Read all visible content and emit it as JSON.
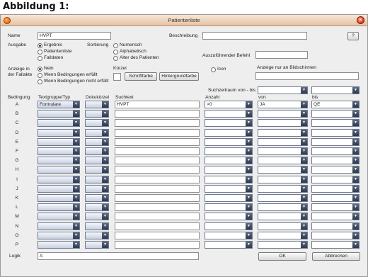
{
  "heading": "Abbildung 1:",
  "window": {
    "title": "Patientenliste",
    "help": "?"
  },
  "top": {
    "name_label": "Name",
    "name_value": "HVPT",
    "beschreibung_label": "Beschreibung",
    "beschreibung_value": "",
    "ausgabe_label": "Ausgabe",
    "ausgabe_options": [
      "Ergebnis",
      "Patientenliste",
      "Falldaten"
    ],
    "sortierung_label": "Sortierung",
    "sortierung_options": [
      "Numerisch",
      "Alphabetisch",
      "Alter des Patienten"
    ],
    "befehl_label": "Auszuführender Befehl",
    "befehl_value": "",
    "anzeige_label_1": "Anzeige in",
    "anzeige_label_2": "der Fallakte",
    "anzeige_options": [
      "Nein",
      "Wenn Bedingungen erfüllt",
      "Wenn Bedingungen nicht erfüllt"
    ],
    "kuerzel_label": "Kürzel",
    "kuerzel_value": "",
    "schriftfarbe": "Schriftfarbe",
    "hintergrundfarbe": "Hintergrundfarbe",
    "icon_label": "Icon",
    "bildschirm_label": "Anzeige nur an Bildschirmen",
    "bildschirm_value": "",
    "suchzeitraum_label": "Suchzeitraum von - bis"
  },
  "table": {
    "headers": [
      "Bedingung",
      "Textgruppe/Typ",
      "Dokukürzel",
      "Suchtext",
      "Anzahl",
      "von",
      "bis"
    ],
    "rows": [
      {
        "id": "A",
        "typ": "Formulare",
        "doku": "",
        "such": "HVPT",
        "anzahl": ">0",
        "von": "JA",
        "bis": "QE"
      },
      {
        "id": "B",
        "typ": "",
        "doku": "",
        "such": "",
        "anzahl": "",
        "von": "",
        "bis": ""
      },
      {
        "id": "C",
        "typ": "",
        "doku": "",
        "such": "",
        "anzahl": "",
        "von": "",
        "bis": ""
      },
      {
        "id": "D",
        "typ": "",
        "doku": "",
        "such": "",
        "anzahl": "",
        "von": "",
        "bis": ""
      },
      {
        "id": "E",
        "typ": "",
        "doku": "",
        "such": "",
        "anzahl": "",
        "von": "",
        "bis": ""
      },
      {
        "id": "F",
        "typ": "",
        "doku": "",
        "such": "",
        "anzahl": "",
        "von": "",
        "bis": ""
      },
      {
        "id": "G",
        "typ": "",
        "doku": "",
        "such": "",
        "anzahl": "",
        "von": "",
        "bis": ""
      },
      {
        "id": "H",
        "typ": "",
        "doku": "",
        "such": "",
        "anzahl": "",
        "von": "",
        "bis": ""
      },
      {
        "id": "I",
        "typ": "",
        "doku": "",
        "such": "",
        "anzahl": "",
        "von": "",
        "bis": ""
      },
      {
        "id": "J",
        "typ": "",
        "doku": "",
        "such": "",
        "anzahl": "",
        "von": "",
        "bis": ""
      },
      {
        "id": "K",
        "typ": "",
        "doku": "",
        "such": "",
        "anzahl": "",
        "von": "",
        "bis": ""
      },
      {
        "id": "L",
        "typ": "",
        "doku": "",
        "such": "",
        "anzahl": "",
        "von": "",
        "bis": ""
      },
      {
        "id": "M",
        "typ": "",
        "doku": "",
        "such": "",
        "anzahl": "",
        "von": "",
        "bis": ""
      },
      {
        "id": "N",
        "typ": "",
        "doku": "",
        "such": "",
        "anzahl": "",
        "von": "",
        "bis": ""
      },
      {
        "id": "O",
        "typ": "",
        "doku": "",
        "such": "",
        "anzahl": "",
        "von": "",
        "bis": ""
      },
      {
        "id": "P",
        "typ": "",
        "doku": "",
        "such": "",
        "anzahl": "",
        "von": "",
        "bis": ""
      }
    ]
  },
  "footer": {
    "logik_label": "Logik",
    "logik_value": "A",
    "ok": "OK",
    "abbrechen": "Abbrechen"
  }
}
